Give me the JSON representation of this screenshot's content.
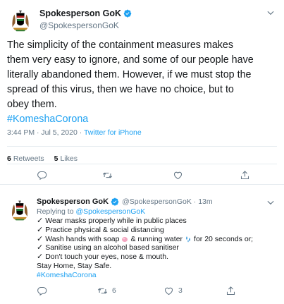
{
  "main_tweet": {
    "display_name": "Spokesperson GoK",
    "handle": "@SpokespersonGoK",
    "text_lines": [
      "The simplicity of the containment measures makes",
      "them very easy to ignore, and some of our people have",
      "literally abandoned them. However, if we must stop the",
      "spread of this virus, then we have no choice, but to",
      "obey them."
    ],
    "hashtag": "#KomeshaCorona",
    "time": "3:44 PM · Jul 5, 2020 · ",
    "source": "Twitter for iPhone",
    "retweets_count": "6",
    "retweets_label": "Retweets",
    "likes_count": "5",
    "likes_label": "Likes"
  },
  "reply_tweet": {
    "display_name": "Spokesperson GoK",
    "handle_time": "@SpokespersonGoK · 13m",
    "replying_prefix": "Replying to ",
    "replying_to": "@SpokespersonGoK",
    "lines": {
      "l1": "Wear masks properly while in public places",
      "l2": "Practice physical & social distancing",
      "l3a": "Wash hands with soap",
      "l3b": "& running water",
      "l3c": "for 20 seconds or;",
      "l4": "Sanitise using an alcohol based sanitiser",
      "l5": "Don't touch your eyes, nose & mouth.",
      "l6": "Stay Home, Stay Safe.",
      "hashtag": "#KomeshaCorona"
    },
    "check_glyph": "✓",
    "retweet_count": "6",
    "like_count": "3"
  },
  "icons": {
    "verified": "verified-badge-icon",
    "chevron": "chevron-down-icon",
    "reply": "reply-icon",
    "retweet": "retweet-icon",
    "like": "heart-icon",
    "share": "share-icon"
  },
  "colors": {
    "accent": "#1da1f2",
    "text": "#14171a",
    "muted": "#657786",
    "divider": "#e6ecf0"
  }
}
